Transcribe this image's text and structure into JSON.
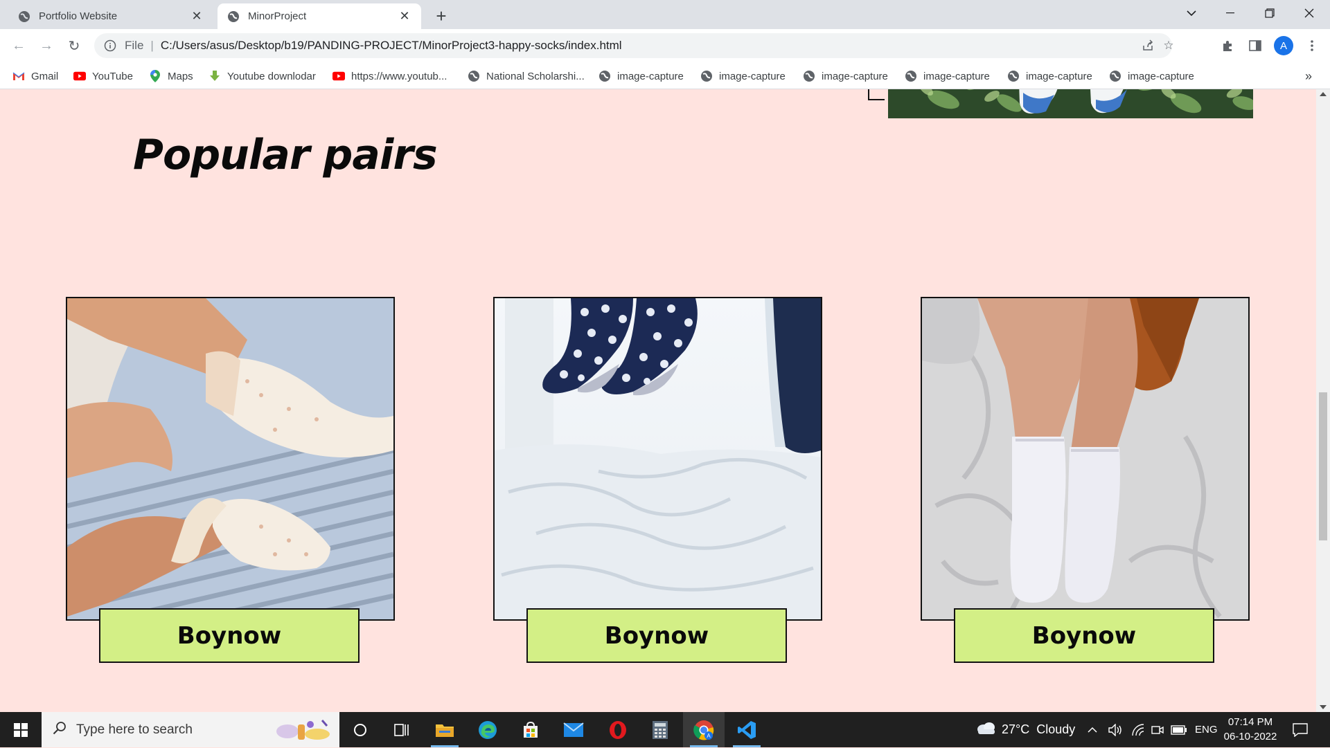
{
  "browser": {
    "tabs": [
      {
        "title": "Portfolio Website",
        "active": false
      },
      {
        "title": "MinorProject",
        "active": true
      }
    ],
    "new_tab_label": "+",
    "address": {
      "scheme_label": "File",
      "url": "C:/Users/asus/Desktop/b19/PANDING-PROJECT/MinorProject3-happy-socks/index.html"
    },
    "profile_initial": "A",
    "bookmarks": [
      {
        "label": "Gmail",
        "icon": "gmail-icon"
      },
      {
        "label": "YouTube",
        "icon": "youtube-icon"
      },
      {
        "label": "Maps",
        "icon": "maps-icon"
      },
      {
        "label": "Youtube downlodar",
        "icon": "download-icon"
      },
      {
        "label": "https://www.youtub...",
        "icon": "youtube-icon"
      },
      {
        "label": "National Scholarshi...",
        "icon": "globe-icon"
      },
      {
        "label": "image-capture",
        "icon": "globe-icon"
      },
      {
        "label": "image-capture",
        "icon": "globe-icon"
      },
      {
        "label": "image-capture",
        "icon": "globe-icon"
      },
      {
        "label": "image-capture",
        "icon": "globe-icon"
      },
      {
        "label": "image-capture",
        "icon": "globe-icon"
      },
      {
        "label": "image-capture",
        "icon": "globe-icon"
      }
    ],
    "bookmarks_overflow": "»"
  },
  "page": {
    "section_title": "Popular pairs",
    "cards": [
      {
        "button_label": "Boynow",
        "image": "ruffled-lace-socks-photo"
      },
      {
        "button_label": "Boynow",
        "image": "polka-dot-socks-jumping-photo"
      },
      {
        "button_label": "Boynow",
        "image": "white-socks-on-bed-photo"
      }
    ],
    "colors": {
      "background": "#ffe3df",
      "button": "#d3ef86",
      "border": "#111111"
    }
  },
  "taskbar": {
    "search_placeholder": "Type here to search",
    "weather": "27°C  Cloudy",
    "language": "ENG",
    "time": "07:14 PM",
    "date": "06-10-2022"
  }
}
